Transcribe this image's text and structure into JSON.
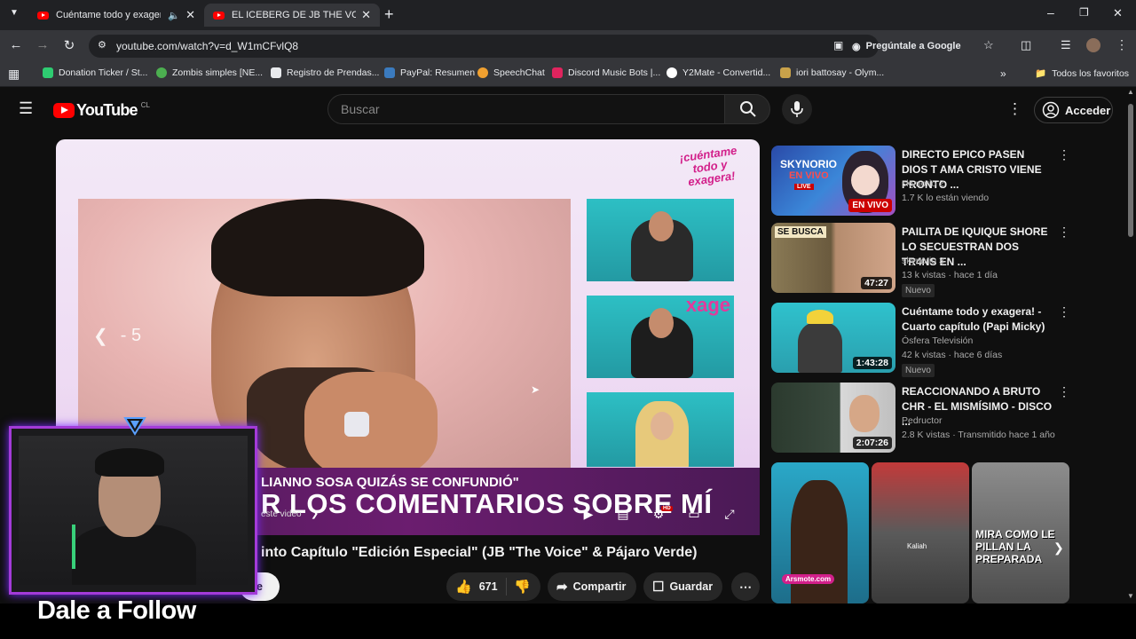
{
  "browser": {
    "tabs": [
      {
        "label": "Cuéntame todo y exagera!"
      },
      {
        "label": "EL ICEBERG DE JB THE VOICE. -"
      }
    ],
    "url": "youtube.com/watch?v=d_W1mCFvlQ8",
    "ask_google": "Pregúntale a Google",
    "bookmarks": [
      {
        "label": "Donation Ticker / St...",
        "color": "#2ecc71"
      },
      {
        "label": "Zombis simples [NE...",
        "color": "#4caf50"
      },
      {
        "label": "Registro de Prendas...",
        "color": "#e8eaed"
      },
      {
        "label": "PayPal: Resumen",
        "color": "#3b7bbf"
      },
      {
        "label": "SpeechChat",
        "color": "#f0a030"
      },
      {
        "label": "Discord Music Bots |...",
        "color": "#e0245e"
      },
      {
        "label": "Y2Mate - Convertid...",
        "color": "#ffffff"
      },
      {
        "label": "iori battosay - Olym...",
        "color": "#c9a24a"
      }
    ],
    "all_bookmarks": "Todos los favoritos"
  },
  "youtube": {
    "logo": "YouTube",
    "region": "CL",
    "search_placeholder": "Buscar",
    "signin": "Acceder"
  },
  "player": {
    "show_logo": "¡cuéntame todo y exagera!",
    "thumb_logo": "xage",
    "seek_back": "- 5",
    "lower_quote": "LIANNO SOSA QUIZÁS SE CONFUNDIÓ\"",
    "lower_headline": "R LOS COMENTARIOS SOBRE MÍ",
    "overlay_text": "este video",
    "hd_badge": "HD"
  },
  "video": {
    "title": "into Capítulo \"Edición Especial\" (JB \"The Voice\" & Pájaro Verde)",
    "subscribe_partial": "se",
    "likes": "671",
    "share": "Compartir",
    "save": "Guardar"
  },
  "recommendations": [
    {
      "title": "DIRECTO EPICO PASEN DIOS T AMA CRISTO VIENE PRONTO ...",
      "channel": "skynorio 2",
      "stats": "1.7 K lo están viendo",
      "badge_live": "EN VIVO",
      "thumb_text": "SKYNORIO",
      "thumb_sub": "EN VIVO",
      "thumb_live": "LIVE"
    },
    {
      "title": "PAILITA DE IQUIQUE SHORE LO SECUESTRAN DOS TR4NS EN ...",
      "channel": "skynorio 3",
      "stats": "13 k vistas · hace 1 día",
      "duration": "47:27",
      "new": "Nuevo",
      "thumb_text": "SE BUSCA"
    },
    {
      "title": "Cuéntame todo y exagera! - Cuarto capítulo (Papi Micky)",
      "channel": "Ósfera Televisión",
      "stats": "42 k vistas · hace 6 días",
      "duration": "1:43:28",
      "new": "Nuevo"
    },
    {
      "title": "REACCIONANDO A BRUTO CHR - EL MISMÍSIMO - DISCO ...",
      "channel": "Pedructor",
      "stats": "2.8 K vistas · Transmitido hace 1 año",
      "duration": "2:07:26"
    }
  ],
  "shorts": [
    {
      "label": "Arsmote.com"
    },
    {
      "label": "Kaliah"
    },
    {
      "label": "MIRA COMO LE PILLAN LA PREPARADA"
    }
  ],
  "stream_overlay": {
    "cta": "Dale a Follow",
    "frame_color": "#a33bd8"
  }
}
